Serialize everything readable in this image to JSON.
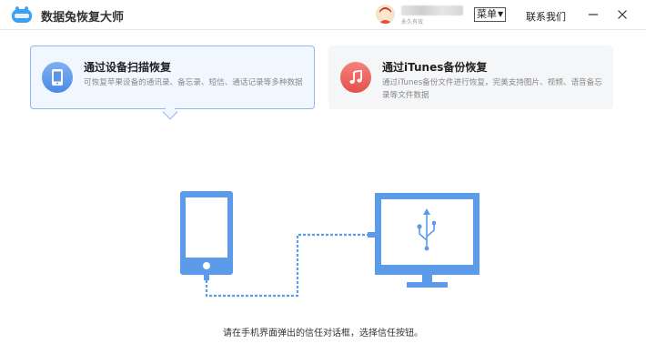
{
  "app": {
    "title": "数据兔恢复大师",
    "logo_icon": "rabbit-logo-icon"
  },
  "account": {
    "status": "永久有效",
    "avatar_icon": "user-avatar-icon"
  },
  "titlebar": {
    "menu_label": "菜单",
    "contact_label": "联系我们",
    "minimize_icon": "minimize-icon",
    "close_icon": "close-icon"
  },
  "options": [
    {
      "title": "通过设备扫描恢复",
      "description": "可恢复苹果设备的通讯录、备忘录、短信、通话记录等多种数据",
      "icon": "phone-icon",
      "selected": true
    },
    {
      "title": "通过iTunes备份恢复",
      "description": "通过iTunes备份文件进行恢复，完美支持图片、视频、语音备忘录等文件数据",
      "icon": "music-note-icon",
      "selected": false
    }
  ],
  "instruction": "请在手机界面弹出的信任对话框，选择信任按钮。",
  "colors": {
    "accent": "#5b9bea",
    "selected_card_bg": "#f1f7ff",
    "selected_card_border": "#8fb8ec",
    "itunes_icon": "#e5514c"
  }
}
